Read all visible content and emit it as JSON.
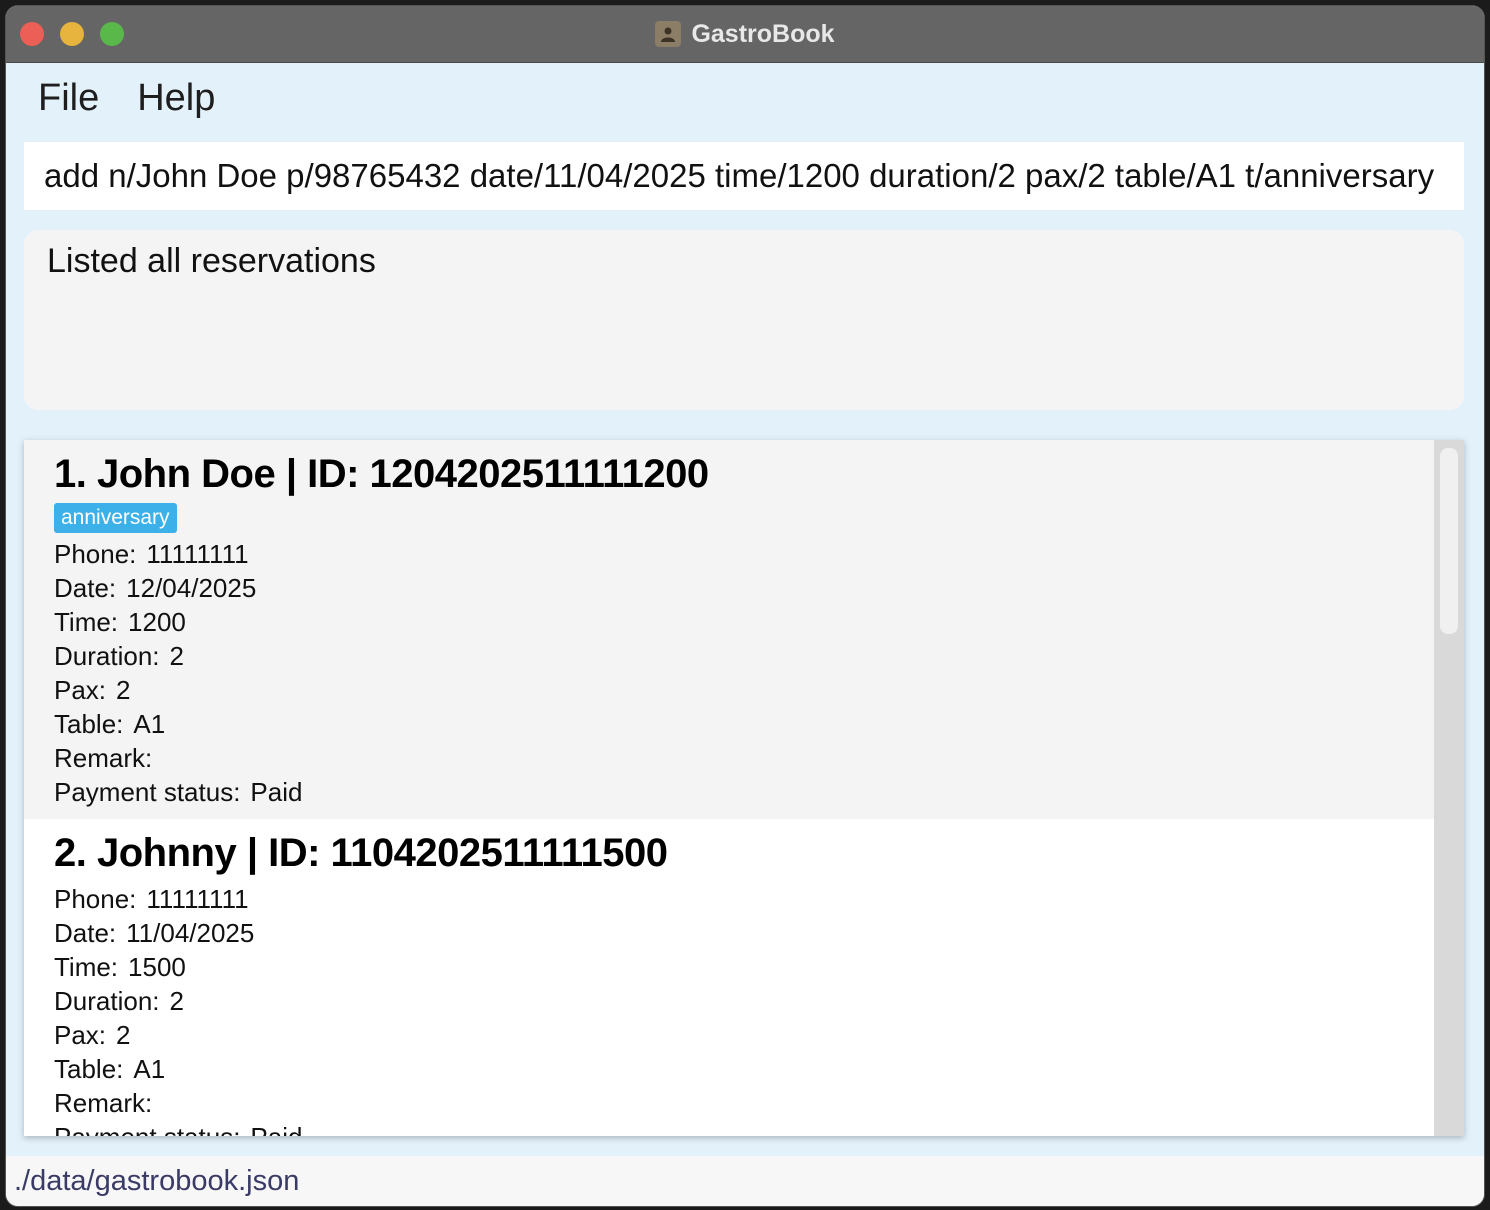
{
  "window": {
    "title": "GastroBook"
  },
  "menu": {
    "file": "File",
    "help": "Help"
  },
  "command": {
    "value": "add n/John Doe p/98765432 date/11/04/2025 time/1200 duration/2 pax/2 table/A1 t/anniversary"
  },
  "result": {
    "message": "Listed all reservations"
  },
  "labels": {
    "phone": "Phone:",
    "date": "Date:",
    "time": "Time:",
    "duration": "Duration:",
    "pax": "Pax:",
    "table": "Table:",
    "remark": "Remark:",
    "payment": "Payment status:"
  },
  "reservations": [
    {
      "title": "1. John Doe | ID: 1204202511111200",
      "tags": [
        "anniversary"
      ],
      "phone": "11111111",
      "date": "12/04/2025",
      "time": "1200",
      "duration": "2",
      "pax": "2",
      "table": "A1",
      "remark": "",
      "payment": "Paid"
    },
    {
      "title": "2. Johnny | ID: 1104202511111500",
      "tags": [],
      "phone": "11111111",
      "date": "11/04/2025",
      "time": "1500",
      "duration": "2",
      "pax": "2",
      "table": "A1",
      "remark": "",
      "payment": "Paid"
    }
  ],
  "status": {
    "file_path": "./data/gastrobook.json"
  },
  "colors": {
    "tag": "#3cb0e8",
    "background": "#e3f1fb",
    "titlebar": "#656565"
  }
}
